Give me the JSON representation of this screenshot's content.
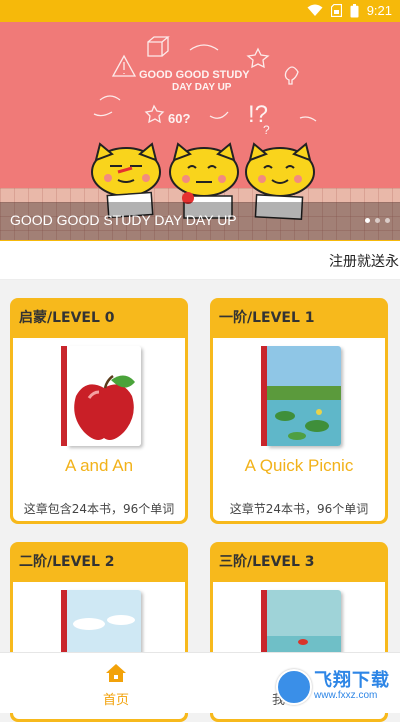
{
  "status_bar": {
    "time": "9:21",
    "icons": [
      "wifi-icon",
      "sim-signal-icon",
      "battery-icon"
    ]
  },
  "banner": {
    "art_heading": "GOOD GOOD STUDY",
    "art_subheading": "DAY DAY UP",
    "caption": "GOOD GOOD STUDY DAY DAY UP",
    "slide_count": 3,
    "active_slide": 1
  },
  "notice": {
    "text": "注册就送永"
  },
  "levels": [
    {
      "level": "启蒙/LEVEL 0",
      "book_title": "A and An",
      "meta": "这章包含24本书，96个单词",
      "cover": "apple"
    },
    {
      "level": "一阶/LEVEL 1",
      "book_title": "A Quick Picnic",
      "meta": "这章节24本书，96个单词",
      "cover": "pond"
    },
    {
      "level": "二阶/LEVEL 2",
      "book_title": "",
      "meta": "",
      "cover": "sky"
    },
    {
      "level": "三阶/LEVEL 3",
      "book_title": "",
      "meta": "",
      "cover": "sea"
    }
  ],
  "nav": {
    "home_label": "首页",
    "mine_label": "我"
  },
  "watermark": {
    "text": "飞翔下载",
    "url": "www.fxxz.com"
  },
  "colors": {
    "accent": "#f6b90a",
    "banner_bg": "#f07a78",
    "title_text": "#f2b21a"
  }
}
